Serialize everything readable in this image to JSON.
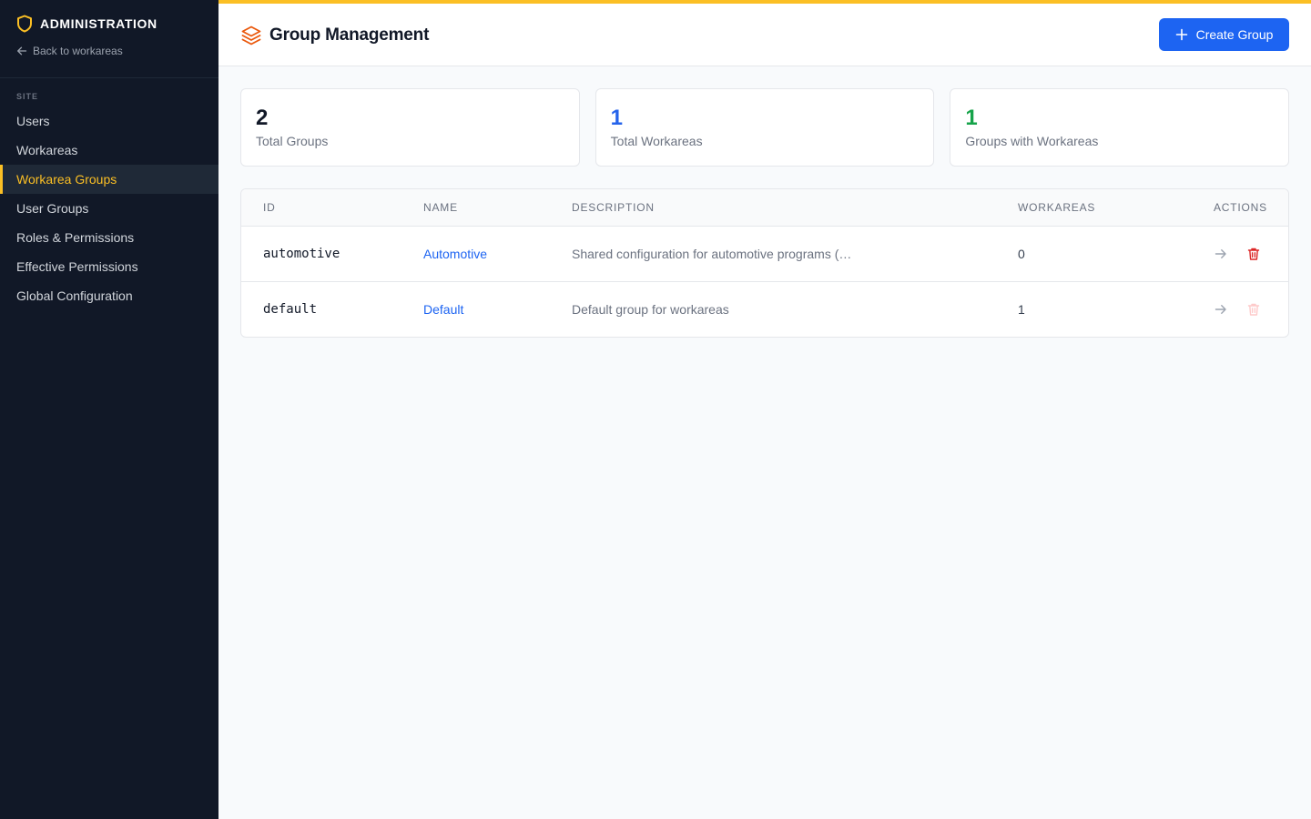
{
  "sidebar": {
    "title": "ADMINISTRATION",
    "back_label": "Back to workareas",
    "section_label": "SITE",
    "items": [
      {
        "label": "Users"
      },
      {
        "label": "Workareas"
      },
      {
        "label": "Workarea Groups"
      },
      {
        "label": "User Groups"
      },
      {
        "label": "Roles & Permissions"
      },
      {
        "label": "Effective Permissions"
      },
      {
        "label": "Global Configuration"
      }
    ],
    "active_item": "Workarea Groups"
  },
  "header": {
    "title": "Group Management",
    "create_button_label": "Create Group"
  },
  "stats": [
    {
      "value": "2",
      "label": "Total Groups",
      "color": "#111827"
    },
    {
      "value": "1",
      "label": "Total Workareas",
      "color": "#2563eb"
    },
    {
      "value": "1",
      "label": "Groups with Workareas",
      "color": "#16a34a"
    }
  ],
  "table": {
    "columns": [
      "ID",
      "NAME",
      "DESCRIPTION",
      "WORKAREAS",
      "ACTIONS"
    ],
    "rows": [
      {
        "id": "automotive",
        "name": "Automotive",
        "description": "Shared configuration for automotive programs (…",
        "workareas": "0",
        "delete_enabled": true
      },
      {
        "id": "default",
        "name": "Default",
        "description": "Default group for workareas",
        "workareas": "1",
        "delete_enabled": false
      }
    ]
  },
  "colors": {
    "accent": "#fbbf24",
    "primary": "#1d64f2",
    "sidebar_bg": "#111827",
    "danger": "#dc2626",
    "logo_orange": "#ea580c"
  },
  "icons": {
    "brand": "shield-icon",
    "back": "arrow-left-icon",
    "page": "layers-icon",
    "create": "plus-icon",
    "open": "arrow-right-icon",
    "delete": "trash-icon"
  }
}
